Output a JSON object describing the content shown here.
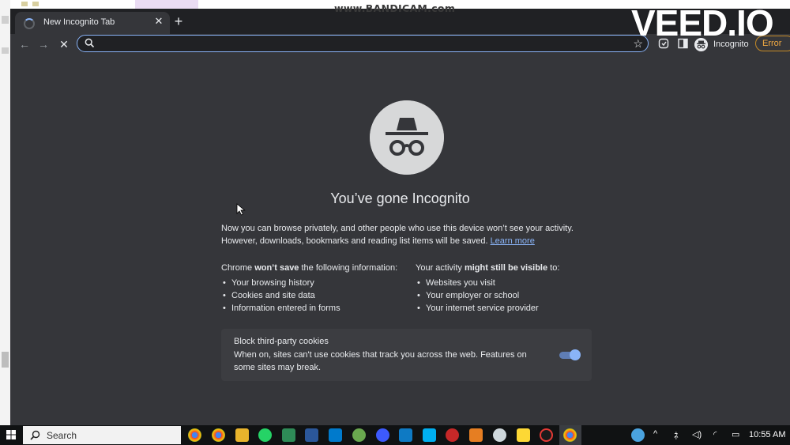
{
  "overlays": {
    "watermark_recorder": "www.BANDICAM.com",
    "watermark_editor": "VEED.IO"
  },
  "tab": {
    "title": "New Incognito Tab",
    "close_icon": "close-icon",
    "new_tab_icon": "plus-icon"
  },
  "toolbar": {
    "back_icon": "arrow-left-icon",
    "forward_icon": "arrow-right-icon",
    "stop_icon": "stop-icon",
    "address_value": "",
    "bookmark_icon": "star-icon",
    "profile_label": "Incognito",
    "error_label": "Error"
  },
  "page": {
    "heading": "You’ve gone Incognito",
    "intro_line1": "Now you can browse privately, and other people who use this device won’t see your activity.",
    "intro_line2": "However, downloads, bookmarks and reading list items will be saved.",
    "learn_more": "Learn more",
    "wont_save": {
      "prefix": "Chrome ",
      "bold": "won’t save",
      "suffix": " the following information:",
      "items": [
        "Your browsing history",
        "Cookies and site data",
        "Information entered in forms"
      ]
    },
    "might_be_visible": {
      "prefix": "Your activity ",
      "bold": "might still be visible",
      "suffix": " to:",
      "items": [
        "Websites you visit",
        "Your employer or school",
        "Your internet service provider"
      ]
    },
    "cookies": {
      "title": "Block third-party cookies",
      "description": "When on, sites can't use cookies that track you across the web. Features on some sites may break.",
      "enabled": true
    }
  },
  "taskbar": {
    "search_placeholder": "Search",
    "time": "10:55 AM",
    "colors": {
      "accent": "#8ab4f8",
      "background": "#35363a",
      "frame": "#202124"
    }
  }
}
